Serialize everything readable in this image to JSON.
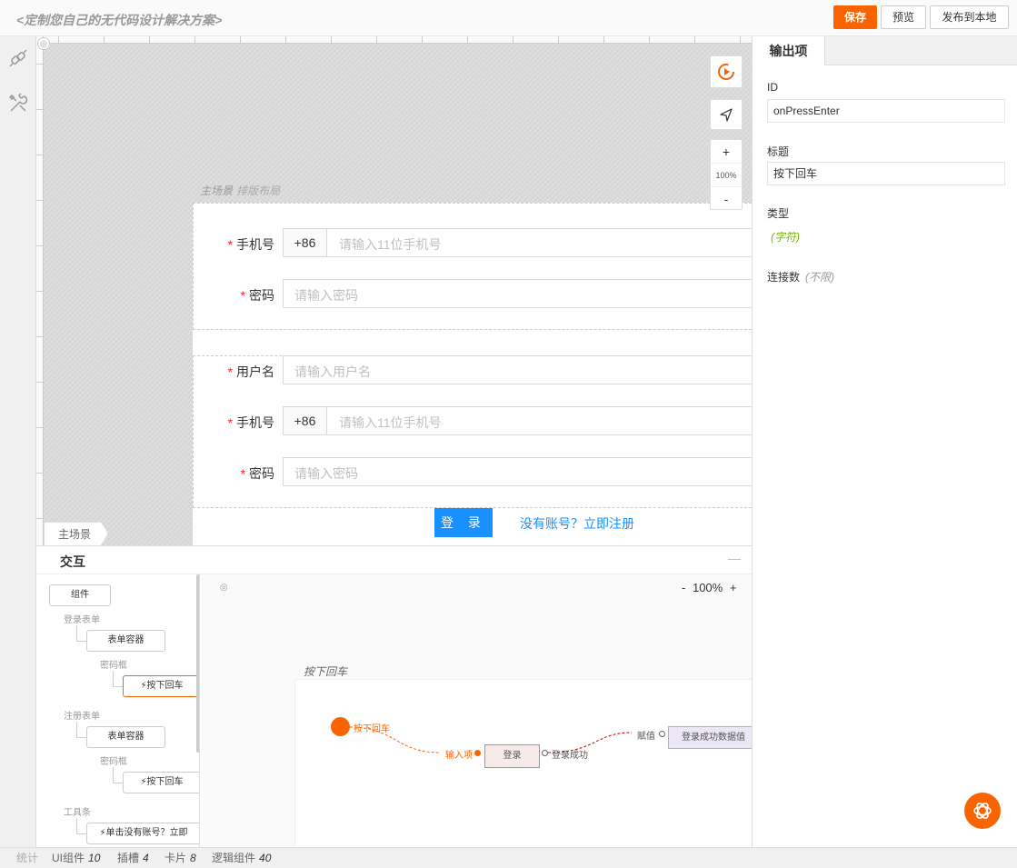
{
  "app": {
    "title": "<定制您自己的无代码设计解决方案>"
  },
  "toolbar": {
    "save": "保存",
    "preview": "预览",
    "publish": "发布到本地"
  },
  "canvas": {
    "scene_label": "主场景",
    "scene_sub": "排版布局",
    "scene_tab": "主场景",
    "zoom": "100%",
    "zoom_in": "+",
    "zoom_out": "-",
    "login_form": {
      "phone_label": "手机号",
      "phone_prefix": "+86",
      "phone_placeholder": "请输入11位手机号",
      "password_label": "密码",
      "password_placeholder": "请输入密码"
    },
    "register_form": {
      "username_label": "用户名",
      "username_placeholder": "请输入用户名",
      "phone_label": "手机号",
      "phone_prefix": "+86",
      "phone_placeholder": "请输入11位手机号",
      "password_label": "密码",
      "password_placeholder": "请输入密码"
    },
    "required_mark": "*",
    "login_button": "登 录",
    "register_link": "没有账号？立即注册"
  },
  "interaction": {
    "title": "交互",
    "collapse": "—",
    "tree": {
      "root": "组件",
      "login_form": "登录表单",
      "login_container": "表单容器",
      "login_password": "密码框",
      "login_enter": "⚡按下回车",
      "register_form": "注册表单",
      "register_container": "表单容器",
      "register_password": "密码框",
      "register_enter": "⚡按下回车",
      "toolbar": "工具条",
      "toolbar_click": "⚡单击没有账号？立即"
    },
    "flow": {
      "zoom_out": "-",
      "zoom": "100%",
      "zoom_in": "+",
      "title": "按下回车",
      "start_label": "按下回车",
      "input_label": "输入项",
      "login_node": "登录",
      "success_label": "登录成功",
      "assign_label": "赋值",
      "data_node": "登录成功数据值"
    }
  },
  "props": {
    "tab": "输出项",
    "id_label": "ID",
    "id_value": "onPressEnter",
    "title_label": "标题",
    "title_value": "按下回车",
    "type_label": "类型",
    "type_value": "(字符)",
    "conn_label": "连接数",
    "conn_value": "(不限)"
  },
  "status": {
    "stats": "统计",
    "ui_label": "UI组件",
    "ui_count": "10",
    "slot_label": "插槽",
    "slot_count": "4",
    "card_label": "卡片",
    "card_count": "8",
    "logic_label": "逻辑组件",
    "logic_count": "40"
  },
  "colors": {
    "accent": "#fa6400",
    "primary": "#1890ff",
    "required": "#f5222d",
    "type": "#7cb305"
  },
  "icons": [
    "plug-icon",
    "tools-icon",
    "debug-play-icon",
    "locate-arrow-icon",
    "assistant-icon"
  ]
}
